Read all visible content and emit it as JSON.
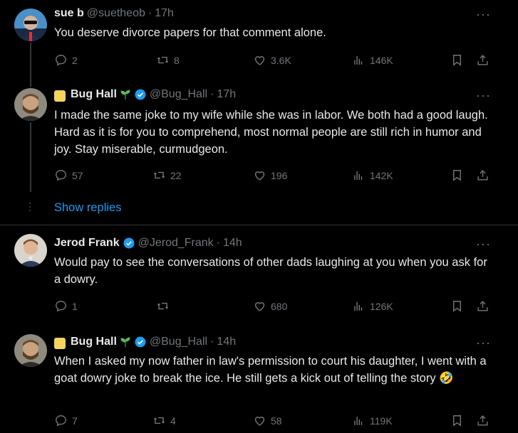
{
  "posts": [
    {
      "name": "sue b",
      "handle": "@suetheob",
      "dot": "·",
      "time": "17h",
      "text": "You deserve divorce papers for that comment alone.",
      "replies": "2",
      "reposts": "8",
      "likes": "3.6K",
      "views": "146K"
    },
    {
      "name": "Bug Hall",
      "handle": "@Bug_Hall",
      "dot": "·",
      "time": "17h",
      "text": "I made the same joke to my wife while she was in labor. We both had a good laugh. Hard as it is for you to comprehend, most normal people are still rich in humor and joy. Stay miserable, curmudgeon.",
      "replies": "57",
      "reposts": "22",
      "likes": "196",
      "views": "142K"
    },
    {
      "name": "Jerod Frank",
      "handle": "@Jerod_Frank",
      "dot": "·",
      "time": "14h",
      "text": "Would pay to see the conversations of other dads laughing at you when you ask for a dowry.",
      "replies": "1",
      "reposts": "",
      "likes": "680",
      "views": "126K"
    },
    {
      "name": "Bug Hall",
      "handle": "@Bug_Hall",
      "dot": "·",
      "time": "14h",
      "text": "When I asked my now father in law's permission to court his daughter, I went with a goat dowry joke to break the ice. He still gets a kick out of telling the story 🤣",
      "replies": "7",
      "reposts": "4",
      "likes": "58",
      "views": "119K"
    }
  ],
  "show_replies": "Show replies",
  "more_glyph": "···",
  "colors": {
    "accent": "#1d9bf0",
    "verified": "#1d9bf0",
    "muted": "#71767b",
    "text": "#e7e9ea"
  }
}
